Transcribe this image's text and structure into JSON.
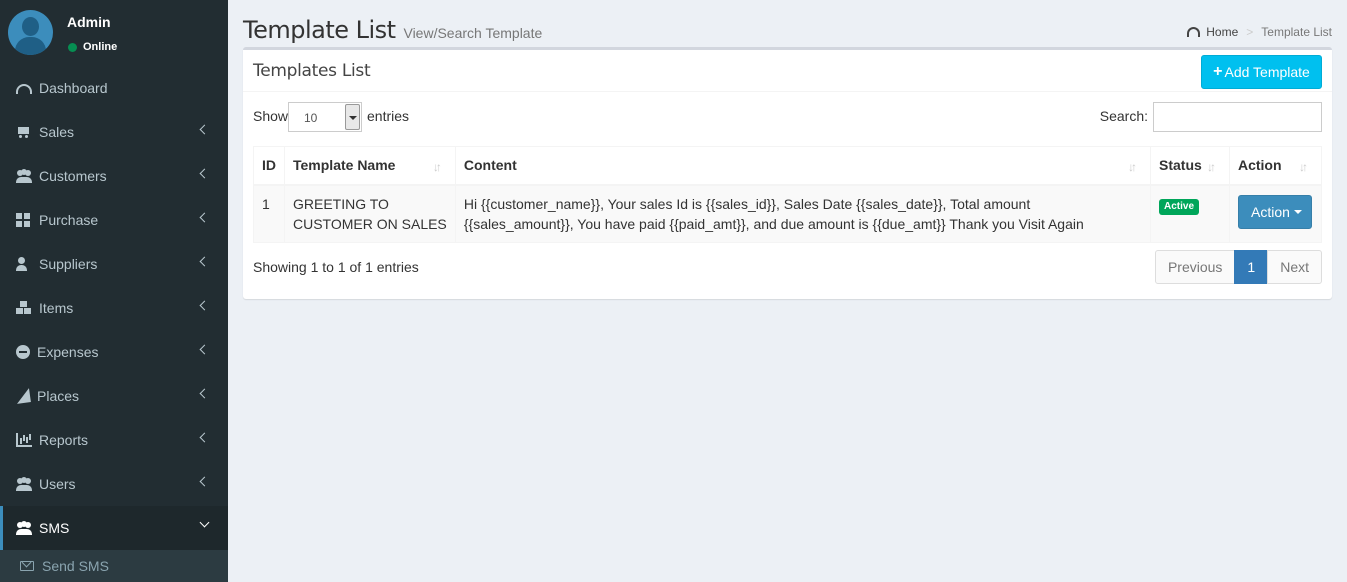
{
  "user": {
    "name": "Admin",
    "status": "Online"
  },
  "sidebar": {
    "items": [
      {
        "label": "Dashboard",
        "icon": "dashboard-icon"
      },
      {
        "label": "Sales",
        "icon": "cart-icon"
      },
      {
        "label": "Customers",
        "icon": "users-icon"
      },
      {
        "label": "Purchase",
        "icon": "grid-icon"
      },
      {
        "label": "Suppliers",
        "icon": "user-plus-icon"
      },
      {
        "label": "Items",
        "icon": "cubes-icon"
      },
      {
        "label": "Expenses",
        "icon": "minus-circle-icon"
      },
      {
        "label": "Places",
        "icon": "paper-plane-icon"
      },
      {
        "label": "Reports",
        "icon": "bar-chart-icon"
      },
      {
        "label": "Users",
        "icon": "users-icon"
      },
      {
        "label": "SMS",
        "icon": "users-icon"
      }
    ],
    "submenu": {
      "label": "Send SMS",
      "icon": "envelope-icon"
    }
  },
  "header": {
    "title": "Template List",
    "subtitle": "View/Search Template",
    "breadcrumb": {
      "home": "Home",
      "current": "Template List"
    }
  },
  "box": {
    "title": "Templates List",
    "add_button": "Add Template"
  },
  "controls": {
    "show_label": "Show",
    "entries_value": "10",
    "entries_label": "entries",
    "search_label": "Search:"
  },
  "table": {
    "columns": [
      "ID",
      "Template Name",
      "Content",
      "Status",
      "Action"
    ],
    "rows": [
      {
        "id": "1",
        "name": "GREETING TO CUSTOMER ON SALES",
        "content": "Hi {{customer_name}}, Your sales Id is {{sales_id}}, Sales Date {{sales_date}}, Total amount {{sales_amount}}, You have paid {{paid_amt}}, and due amount is {{due_amt}} Thank you Visit Again",
        "status": "Active",
        "action": "Action"
      }
    ]
  },
  "footer": {
    "info": "Showing 1 to 1 of 1 entries",
    "pagination": {
      "previous": "Previous",
      "current": "1",
      "next": "Next"
    }
  },
  "colors": {
    "sidebar_bg": "#222d32",
    "accent": "#3c8dbc",
    "add_button": "#00c0ef",
    "status_active": "#00a65a"
  }
}
